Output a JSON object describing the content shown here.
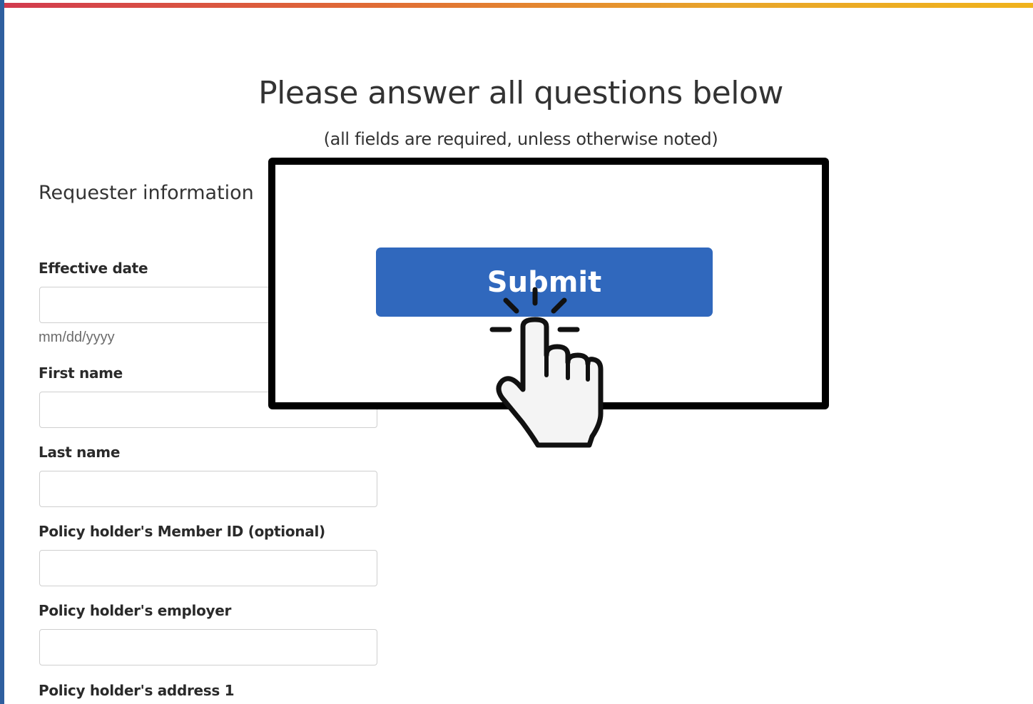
{
  "colors": {
    "accent_left_edge": "#2f5f9f",
    "top_gradient": [
      "#d23a4e",
      "#e06a35",
      "#e8a52a",
      "#f0b31c"
    ],
    "submit_button": "#3068bd",
    "callout_border": "#000000"
  },
  "header": {
    "title": "Please answer all questions below",
    "subtitle": "(all fields are required, unless otherwise noted)"
  },
  "section": {
    "title": "Requester information"
  },
  "form": {
    "effective_date": {
      "label": "Effective date",
      "value": "",
      "hint": "mm/dd/yyyy"
    },
    "first_name": {
      "label": "First name",
      "value": ""
    },
    "last_name": {
      "label": "Last name",
      "value": ""
    },
    "member_id": {
      "label": "Policy holder's Member ID (optional)",
      "value": ""
    },
    "employer": {
      "label": "Policy holder's employer",
      "value": ""
    },
    "address1": {
      "label": "Policy holder's address 1"
    }
  },
  "callout": {
    "submit_label": "Submit",
    "pointer_icon": "hand-pointer-click-icon"
  }
}
